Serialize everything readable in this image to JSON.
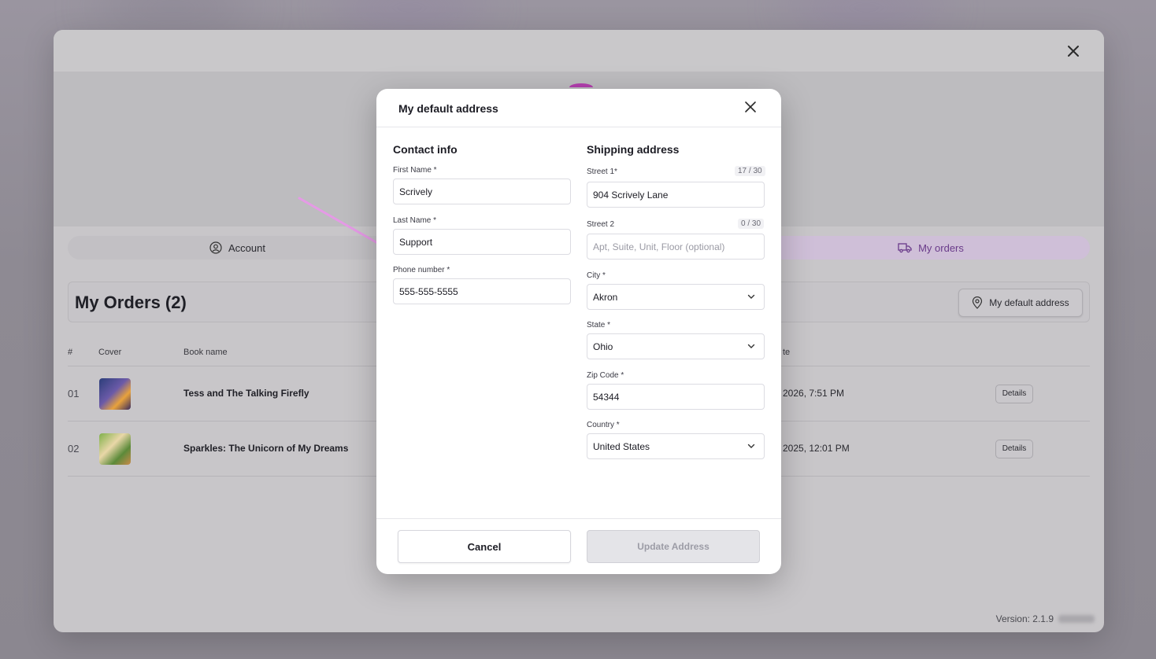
{
  "outer": {
    "tabs": {
      "account": "Account",
      "orders": "My orders"
    },
    "orders_title": "My Orders (2)",
    "default_address_button": "My default address",
    "table": {
      "headers": [
        "#",
        "Cover",
        "Book name",
        "te"
      ],
      "rows": [
        {
          "num": "01",
          "book": "Tess and The Talking Firefly",
          "date": "2026, 7:51 PM",
          "details": "Details"
        },
        {
          "num": "02",
          "book": "Sparkles: The Unicorn of My Dreams",
          "date": "2025, 12:01 PM",
          "details": "Details"
        }
      ]
    },
    "version": "Version: 2.1.9"
  },
  "dialog": {
    "title": "My default address",
    "contact": {
      "title": "Contact info",
      "first_name_label": "First Name *",
      "first_name_value": "Scrively",
      "last_name_label": "Last Name *",
      "last_name_value": "Support",
      "phone_label": "Phone number *",
      "phone_value": "555-555-5555"
    },
    "shipping": {
      "title": "Shipping address",
      "street1_label": "Street 1*",
      "street1_counter": "17 / 30",
      "street1_value": "904 Scrively Lane",
      "street2_label": "Street 2",
      "street2_counter": "0 / 30",
      "street2_placeholder": "Apt, Suite, Unit, Floor (optional)",
      "city_label": "City *",
      "city_value": "Akron",
      "state_label": "State *",
      "state_value": "Ohio",
      "zip_label": "Zip Code *",
      "zip_value": "54344",
      "country_label": "Country *",
      "country_value": "United States"
    },
    "cancel_label": "Cancel",
    "update_label": "Update Address"
  },
  "colors": {
    "accent_purple": "#6a3b8a",
    "arrow_pink": "#e59ae6",
    "brand_pink": "#b33fae"
  }
}
